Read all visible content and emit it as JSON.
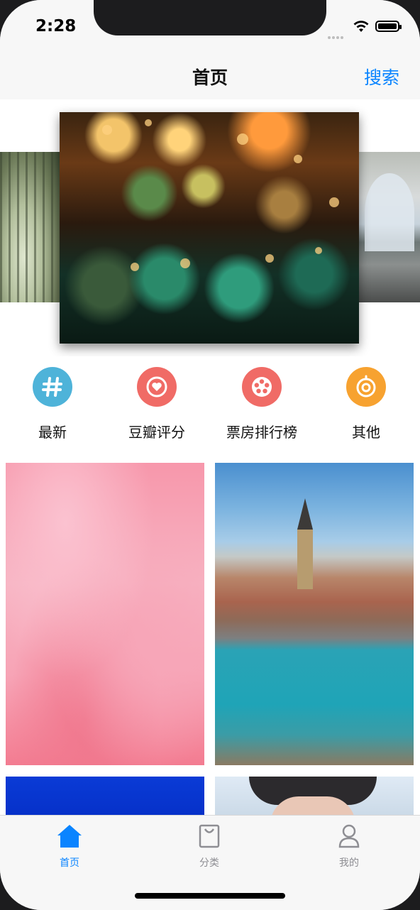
{
  "status_bar": {
    "time": "2:28"
  },
  "navbar": {
    "title": "首页",
    "search_label": "搜索"
  },
  "categories": [
    {
      "label": "最新",
      "icon": "hash-icon",
      "color": "#4eb3d9"
    },
    {
      "label": "豆瓣评分",
      "icon": "heart-icon",
      "color": "#f06b66"
    },
    {
      "label": "票房排行榜",
      "icon": "film-reel-icon",
      "color": "#f06b66"
    },
    {
      "label": "其他",
      "icon": "target-icon",
      "color": "#f7a230"
    }
  ],
  "tabs": [
    {
      "label": "首页",
      "icon": "home-icon",
      "active": true
    },
    {
      "label": "分类",
      "icon": "bag-icon",
      "active": false
    },
    {
      "label": "我的",
      "icon": "profile-icon",
      "active": false
    }
  ],
  "colors": {
    "accent": "#0a84ff",
    "inactive": "#8e8e93"
  }
}
